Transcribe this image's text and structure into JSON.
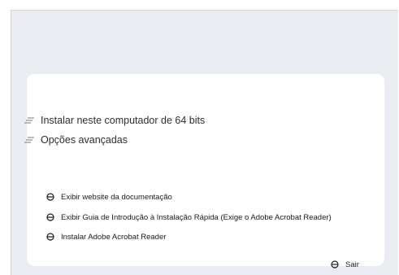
{
  "main_options": [
    {
      "label": "Instalar neste computador de 64 bits",
      "icon": "lines-icon"
    },
    {
      "label": "Opções avançadas",
      "icon": "lines-icon"
    }
  ],
  "links": [
    {
      "label": "Exibir website da documentação",
      "icon": "disc-bullet-icon"
    },
    {
      "label": "Exibir Guia de Introdução à Instalação Rápida (Exige o Adobe Acrobat Reader)",
      "icon": "disc-bullet-icon"
    },
    {
      "label": "Instalar Adobe Acrobat Reader",
      "icon": "disc-bullet-icon"
    }
  ],
  "exit": {
    "label": "Sair",
    "icon": "disc-bullet-icon"
  },
  "colors": {
    "background_panel": "#e9ecf1",
    "card": "#ffffff",
    "text": "#2f2f2f"
  }
}
